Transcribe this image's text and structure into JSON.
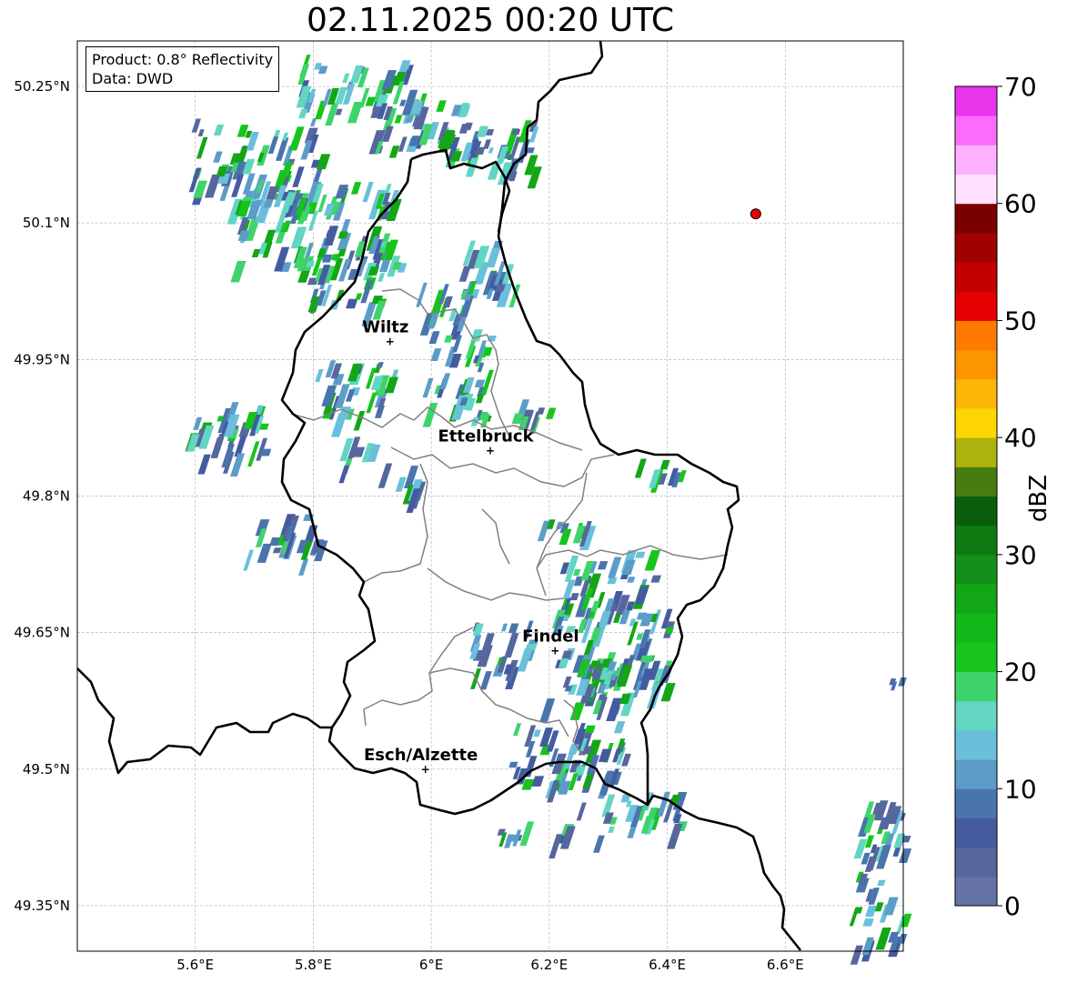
{
  "title": "02.11.2025 00:20 UTC",
  "info": {
    "product": "Product: 0.8° Reflectivity",
    "data": "Data: DWD"
  },
  "map": {
    "lon_range": [
      5.4,
      6.8
    ],
    "lat_range": [
      49.3,
      50.3
    ],
    "lon_ticks": [
      5.6,
      5.8,
      6.0,
      6.2,
      6.4,
      6.6
    ],
    "lon_tick_labels": [
      "5.6°E",
      "5.8°E",
      "6°E",
      "6.2°E",
      "6.4°E",
      "6.6°E"
    ],
    "lat_ticks": [
      49.35,
      49.5,
      49.65,
      49.8,
      49.95,
      50.1,
      50.25
    ],
    "lat_tick_labels": [
      "49.35°N",
      "49.5°N",
      "49.65°N",
      "49.8°N",
      "49.95°N",
      "50.1°N",
      "50.25°N"
    ],
    "grid": true,
    "cities": [
      {
        "name": "Wiltz",
        "lon": 5.93,
        "lat": 49.97
      },
      {
        "name": "Ettelbruck",
        "lon": 6.1,
        "lat": 49.85
      },
      {
        "name": "Findel",
        "lon": 6.21,
        "lat": 49.63
      },
      {
        "name": "Esch/Alzette",
        "lon": 5.99,
        "lat": 49.5
      }
    ],
    "radar_site": {
      "lon": 6.55,
      "lat": 50.11,
      "color": "#e60000"
    }
  },
  "colorbar": {
    "label": "dBZ",
    "min": 0,
    "max": 70,
    "ticks": [
      0,
      10,
      20,
      30,
      40,
      50,
      60,
      70
    ],
    "colors": [
      "#6673a6",
      "#56679e",
      "#445ba0",
      "#4a74ad",
      "#5c9cc8",
      "#6abfdb",
      "#62d5c3",
      "#3fd36c",
      "#16c41c",
      "#14b81a",
      "#13a616",
      "#12901a",
      "#0e7b12",
      "#0a5e0e",
      "#487b10",
      "#aeb20c",
      "#fcd502",
      "#fbb608",
      "#fc9600",
      "#fc7b00",
      "#e40000",
      "#c20000",
      "#a00000",
      "#7a0000",
      "#ffe2ff",
      "#ffb1ff",
      "#fe6cfe",
      "#e936ed"
    ]
  }
}
